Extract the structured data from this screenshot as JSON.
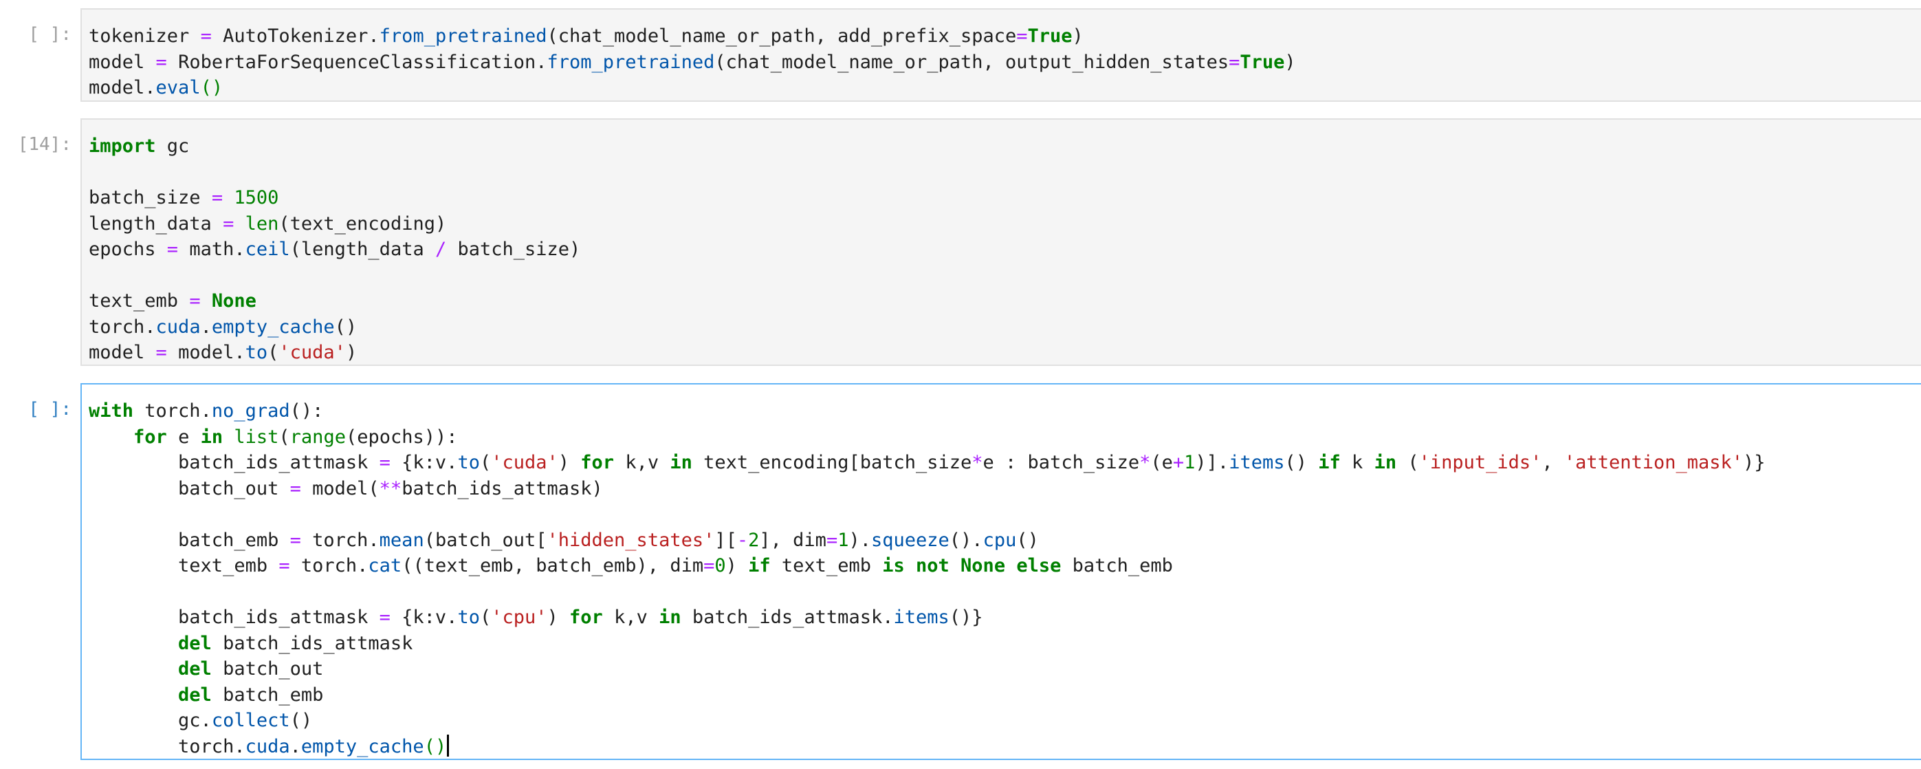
{
  "colors": {
    "keyword": "#008000",
    "operator": "#aa22ff",
    "number": "#008000",
    "string": "#ba2121",
    "function": "#0055aa",
    "cell_background": "#f5f5f5",
    "active_border": "#64b5f6",
    "prompt": "#9e9e9e",
    "active_prompt": "#307fc1"
  },
  "cells": [
    {
      "prompt": "[ ]:",
      "active": false,
      "lines": [
        [
          {
            "t": "tokenizer "
          },
          {
            "t": "=",
            "c": "op"
          },
          {
            "t": " AutoTokenizer."
          },
          {
            "t": "from_pretrained",
            "c": "fn"
          },
          {
            "t": "(chat_model_name_or_path, add_prefix_space"
          },
          {
            "t": "=",
            "c": "op"
          },
          {
            "t": "True",
            "c": "kw"
          },
          {
            "t": ")"
          }
        ],
        [
          {
            "t": "model "
          },
          {
            "t": "=",
            "c": "op"
          },
          {
            "t": " RobertaForSequenceClassification."
          },
          {
            "t": "from_pretrained",
            "c": "fn"
          },
          {
            "t": "(chat_model_name_or_path, output_hidden_states"
          },
          {
            "t": "=",
            "c": "op"
          },
          {
            "t": "True",
            "c": "kw"
          },
          {
            "t": ")"
          }
        ],
        [
          {
            "t": "model."
          },
          {
            "t": "eval",
            "c": "fn"
          },
          {
            "t": "()",
            "c": "br"
          }
        ]
      ]
    },
    {
      "prompt": "[14]:",
      "active": false,
      "lines": [
        [
          {
            "t": "import",
            "c": "kw"
          },
          {
            "t": " gc"
          }
        ],
        [],
        [
          {
            "t": "batch_size "
          },
          {
            "t": "=",
            "c": "op"
          },
          {
            "t": " "
          },
          {
            "t": "1500",
            "c": "num"
          }
        ],
        [
          {
            "t": "length_data "
          },
          {
            "t": "=",
            "c": "op"
          },
          {
            "t": " "
          },
          {
            "t": "len",
            "c": "bi"
          },
          {
            "t": "(text_encoding)"
          }
        ],
        [
          {
            "t": "epochs "
          },
          {
            "t": "=",
            "c": "op"
          },
          {
            "t": " math."
          },
          {
            "t": "ceil",
            "c": "fn"
          },
          {
            "t": "(length_data "
          },
          {
            "t": "/",
            "c": "op"
          },
          {
            "t": " batch_size)"
          }
        ],
        [],
        [
          {
            "t": "text_emb "
          },
          {
            "t": "=",
            "c": "op"
          },
          {
            "t": " "
          },
          {
            "t": "None",
            "c": "kw"
          }
        ],
        [
          {
            "t": "torch."
          },
          {
            "t": "cuda",
            "c": "fn"
          },
          {
            "t": "."
          },
          {
            "t": "empty_cache",
            "c": "fn"
          },
          {
            "t": "()"
          }
        ],
        [
          {
            "t": "model "
          },
          {
            "t": "=",
            "c": "op"
          },
          {
            "t": " model."
          },
          {
            "t": "to",
            "c": "fn"
          },
          {
            "t": "("
          },
          {
            "t": "'cuda'",
            "c": "str"
          },
          {
            "t": ")"
          }
        ]
      ]
    },
    {
      "prompt": "[ ]:",
      "active": true,
      "lines": [
        [
          {
            "t": "with",
            "c": "kw"
          },
          {
            "t": " torch."
          },
          {
            "t": "no_grad",
            "c": "fn"
          },
          {
            "t": "():"
          }
        ],
        [
          {
            "t": "    "
          },
          {
            "t": "for",
            "c": "kw"
          },
          {
            "t": " e "
          },
          {
            "t": "in",
            "c": "kw"
          },
          {
            "t": " "
          },
          {
            "t": "list",
            "c": "bi"
          },
          {
            "t": "("
          },
          {
            "t": "range",
            "c": "bi"
          },
          {
            "t": "(epochs)):"
          }
        ],
        [
          {
            "t": "        batch_ids_attmask "
          },
          {
            "t": "=",
            "c": "op"
          },
          {
            "t": " {k:v."
          },
          {
            "t": "to",
            "c": "fn"
          },
          {
            "t": "("
          },
          {
            "t": "'cuda'",
            "c": "str"
          },
          {
            "t": ") "
          },
          {
            "t": "for",
            "c": "kw"
          },
          {
            "t": " k,v "
          },
          {
            "t": "in",
            "c": "kw"
          },
          {
            "t": " text_encoding[batch_size"
          },
          {
            "t": "*",
            "c": "op"
          },
          {
            "t": "e : batch_size"
          },
          {
            "t": "*",
            "c": "op"
          },
          {
            "t": "(e"
          },
          {
            "t": "+",
            "c": "op"
          },
          {
            "t": "1",
            "c": "num"
          },
          {
            "t": ")]."
          },
          {
            "t": "items",
            "c": "fn"
          },
          {
            "t": "() "
          },
          {
            "t": "if",
            "c": "kw"
          },
          {
            "t": " k "
          },
          {
            "t": "in",
            "c": "kw"
          },
          {
            "t": " ("
          },
          {
            "t": "'input_ids'",
            "c": "str"
          },
          {
            "t": ", "
          },
          {
            "t": "'attention_mask'",
            "c": "str"
          },
          {
            "t": ")}"
          }
        ],
        [
          {
            "t": "        batch_out "
          },
          {
            "t": "=",
            "c": "op"
          },
          {
            "t": " model("
          },
          {
            "t": "**",
            "c": "op"
          },
          {
            "t": "batch_ids_attmask)"
          }
        ],
        [],
        [
          {
            "t": "        batch_emb "
          },
          {
            "t": "=",
            "c": "op"
          },
          {
            "t": " torch."
          },
          {
            "t": "mean",
            "c": "fn"
          },
          {
            "t": "(batch_out["
          },
          {
            "t": "'hidden_states'",
            "c": "str"
          },
          {
            "t": "]["
          },
          {
            "t": "-",
            "c": "op"
          },
          {
            "t": "2",
            "c": "num"
          },
          {
            "t": "], dim"
          },
          {
            "t": "=",
            "c": "op"
          },
          {
            "t": "1",
            "c": "num"
          },
          {
            "t": ")."
          },
          {
            "t": "squeeze",
            "c": "fn"
          },
          {
            "t": "()."
          },
          {
            "t": "cpu",
            "c": "fn"
          },
          {
            "t": "()"
          }
        ],
        [
          {
            "t": "        text_emb "
          },
          {
            "t": "=",
            "c": "op"
          },
          {
            "t": " torch."
          },
          {
            "t": "cat",
            "c": "fn"
          },
          {
            "t": "((text_emb, batch_emb), dim"
          },
          {
            "t": "=",
            "c": "op"
          },
          {
            "t": "0",
            "c": "num"
          },
          {
            "t": ") "
          },
          {
            "t": "if",
            "c": "kw"
          },
          {
            "t": " text_emb "
          },
          {
            "t": "is",
            "c": "kw"
          },
          {
            "t": " "
          },
          {
            "t": "not",
            "c": "kw"
          },
          {
            "t": " "
          },
          {
            "t": "None",
            "c": "kw"
          },
          {
            "t": " "
          },
          {
            "t": "else",
            "c": "kw"
          },
          {
            "t": " batch_emb"
          }
        ],
        [],
        [
          {
            "t": "        batch_ids_attmask "
          },
          {
            "t": "=",
            "c": "op"
          },
          {
            "t": " {k:v."
          },
          {
            "t": "to",
            "c": "fn"
          },
          {
            "t": "("
          },
          {
            "t": "'cpu'",
            "c": "str"
          },
          {
            "t": ") "
          },
          {
            "t": "for",
            "c": "kw"
          },
          {
            "t": " k,v "
          },
          {
            "t": "in",
            "c": "kw"
          },
          {
            "t": " batch_ids_attmask."
          },
          {
            "t": "items",
            "c": "fn"
          },
          {
            "t": "()}"
          }
        ],
        [
          {
            "t": "        "
          },
          {
            "t": "del",
            "c": "kw"
          },
          {
            "t": " batch_ids_attmask"
          }
        ],
        [
          {
            "t": "        "
          },
          {
            "t": "del",
            "c": "kw"
          },
          {
            "t": " batch_out"
          }
        ],
        [
          {
            "t": "        "
          },
          {
            "t": "del",
            "c": "kw"
          },
          {
            "t": " batch_emb"
          }
        ],
        [
          {
            "t": "        gc."
          },
          {
            "t": "collect",
            "c": "fn"
          },
          {
            "t": "()"
          }
        ],
        [
          {
            "t": "        torch."
          },
          {
            "t": "cuda",
            "c": "fn"
          },
          {
            "t": "."
          },
          {
            "t": "empty_cache",
            "c": "fn"
          },
          {
            "t": "()",
            "c": "br"
          }
        ]
      ]
    }
  ]
}
